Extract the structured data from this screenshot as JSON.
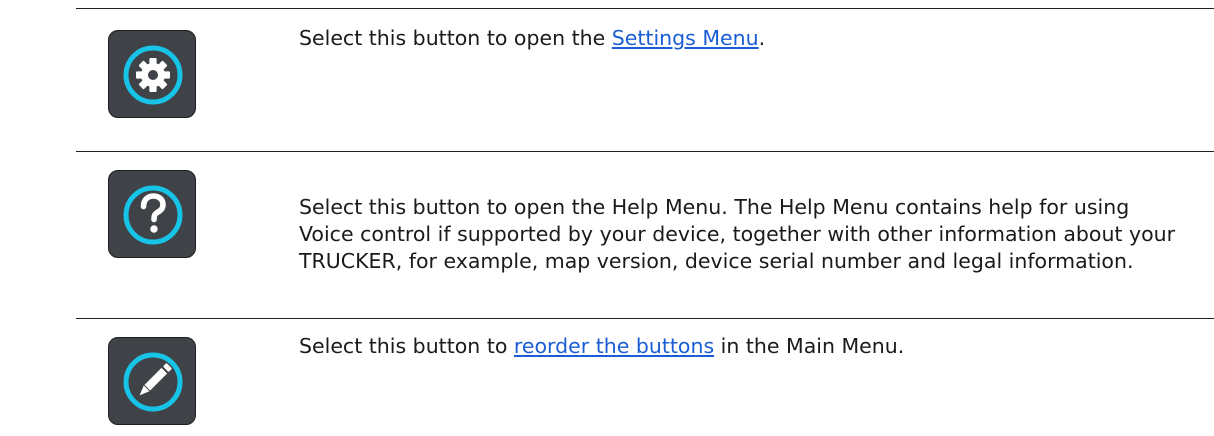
{
  "rows": [
    {
      "icon": "gear-icon",
      "text_before": "Select this button to open the ",
      "link": "Settings Menu",
      "text_after": "."
    },
    {
      "icon": "question-icon",
      "text": "Select this button to open the Help Menu. The Help Menu contains help for using Voice control if supported by your device, together with other information about your TRUCKER, for example, map version, device serial number and legal information."
    },
    {
      "icon": "pencil-icon",
      "text_before": "Select this button to ",
      "link": "reorder the buttons",
      "text_after": " in the Main Menu."
    }
  ],
  "colors": {
    "button_bg": "#3f4246",
    "icon_accent": "#18c3e8",
    "link": "#1a5dd6",
    "rule": "#222222"
  }
}
